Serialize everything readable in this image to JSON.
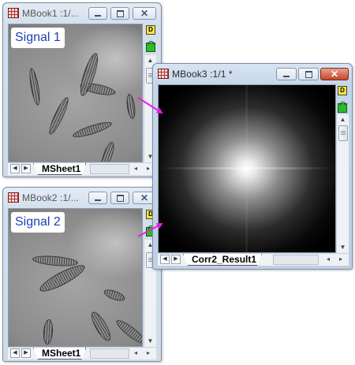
{
  "windows": {
    "mbook1": {
      "title": "MBook1 :1/...",
      "overlay_label": "Signal 1",
      "sheet_tab": "MSheet1"
    },
    "mbook2": {
      "title": "MBook2 :1/...",
      "overlay_label": "Signal 2",
      "sheet_tab": "MSheet1"
    },
    "mbook3": {
      "title": "MBook3 :1/1  *",
      "sheet_tab": "Corr2_Result1"
    }
  },
  "side_buttons": {
    "d_label": "D"
  },
  "icons": {
    "window_icon": "matrix-book-icon",
    "minimize": "minimize-icon",
    "maximize": "maximize-icon",
    "close": "close-icon",
    "lock": "lock-icon",
    "pointer_arrows": "magenta-arrow"
  },
  "colors": {
    "label_text": "#1f3fb5",
    "arrow": "#e81ee0",
    "close_active": "#c3472a"
  }
}
